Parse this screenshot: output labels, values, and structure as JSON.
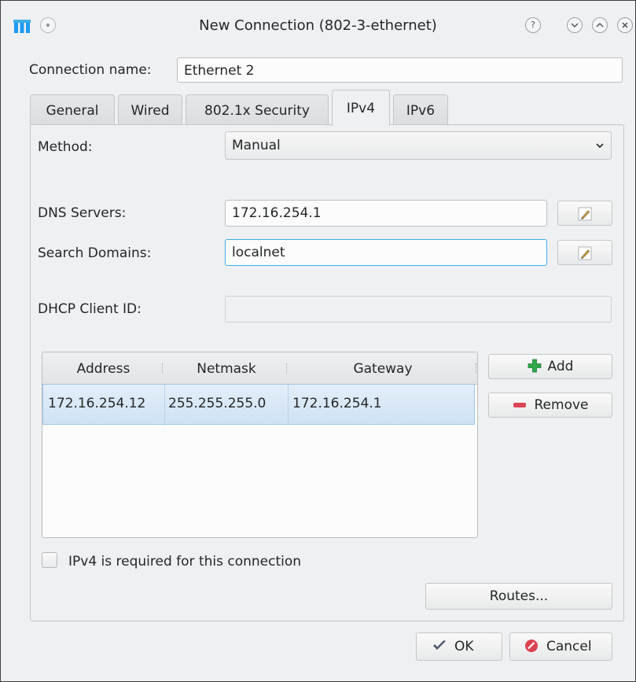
{
  "window": {
    "title": "New Connection (802-3-ethernet)",
    "buttons": [
      "?",
      "⌄",
      "⌃",
      "×"
    ]
  },
  "connection": {
    "name_label": "Connection name:",
    "name_value": "Ethernet 2"
  },
  "tabs": [
    {
      "label": "General",
      "active": false
    },
    {
      "label": "Wired",
      "active": false
    },
    {
      "label": "802.1x Security",
      "active": false
    },
    {
      "label": "IPv4",
      "active": true
    },
    {
      "label": "IPv6",
      "active": false
    }
  ],
  "ipv4": {
    "method_label": "Method:",
    "method_value": "Manual",
    "dns_label": "DNS Servers:",
    "dns_value": "172.16.254.1",
    "search_label": "Search Domains:",
    "search_value": "localnet",
    "dhcp_label": "DHCP Client ID:",
    "dhcp_value": "",
    "table": {
      "columns": [
        "Address",
        "Netmask",
        "Gateway"
      ],
      "rows": [
        [
          "172.16.254.12",
          "255.255.255.0",
          "172.16.254.1"
        ]
      ]
    },
    "add_label": "Add",
    "remove_label": "Remove",
    "required_label": "IPv4 is required for this connection",
    "required_checked": false,
    "routes_label": "Routes..."
  },
  "dialog": {
    "ok_label": "OK",
    "cancel_label": "Cancel"
  },
  "colors": {
    "accent": "#3daee9",
    "add_icon": "#2ea84a",
    "remove_icon": "#da4453",
    "cancel_icon": "#da4453"
  }
}
